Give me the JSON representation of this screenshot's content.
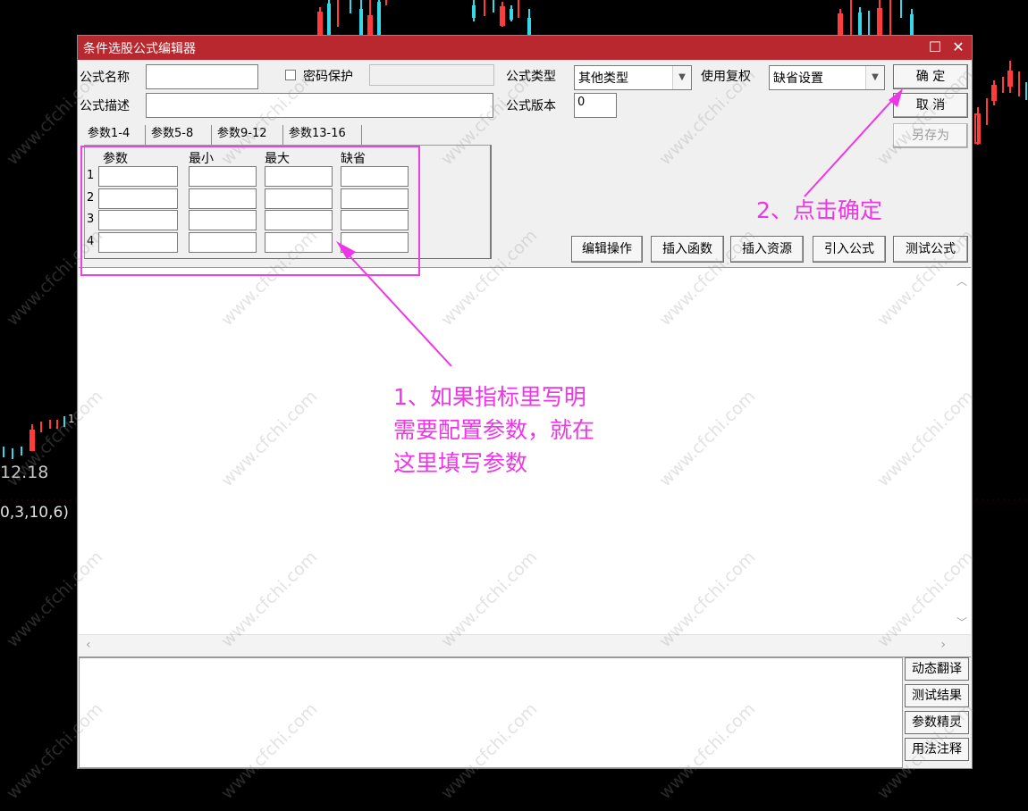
{
  "dialog": {
    "title": "条件选股公式编辑器",
    "maximize_glyph": "☐",
    "close_glyph": "✕"
  },
  "form": {
    "name_label": "公式名称",
    "name_value": "",
    "password_label": "密码保护",
    "password_checked": false,
    "password_value": "",
    "desc_label": "公式描述",
    "desc_value": "",
    "type_label": "公式类型",
    "type_value": "其他类型",
    "rights_label": "使用复权",
    "rights_value": "缺省设置",
    "version_label": "公式版本",
    "version_value": "0"
  },
  "buttons": {
    "ok": "确  定",
    "cancel": "取  消",
    "save_as": "另存为",
    "edit_ops": "编辑操作",
    "insert_func": "插入函数",
    "insert_res": "插入资源",
    "import_formula": "引入公式",
    "test_formula": "测试公式"
  },
  "tabs": [
    "参数1-4",
    "参数5-8",
    "参数9-12",
    "参数13-16"
  ],
  "param_table": {
    "headers": [
      "参数",
      "最小",
      "最大",
      "缺省"
    ],
    "rows": [
      "1",
      "2",
      "3",
      "4"
    ]
  },
  "side_buttons": [
    "动态翻译",
    "测试结果",
    "参数精灵",
    "用法注释"
  ],
  "annotations": {
    "note1_line1": "1、如果指标里写明",
    "note1_line2": "需要配置参数，就在",
    "note1_line3": "这里填写参数",
    "note2": "2、点击确定"
  },
  "background": {
    "price_label": "12.18",
    "indicator_label": "0,3,10,6)",
    "tick_label": "1"
  },
  "watermark": "www.cfchi.com",
  "colors": {
    "titlebar": "#b8282e",
    "annotation": "#ef35e8",
    "up_candle": "#ff3b3b",
    "down_candle": "#36d7e8"
  }
}
